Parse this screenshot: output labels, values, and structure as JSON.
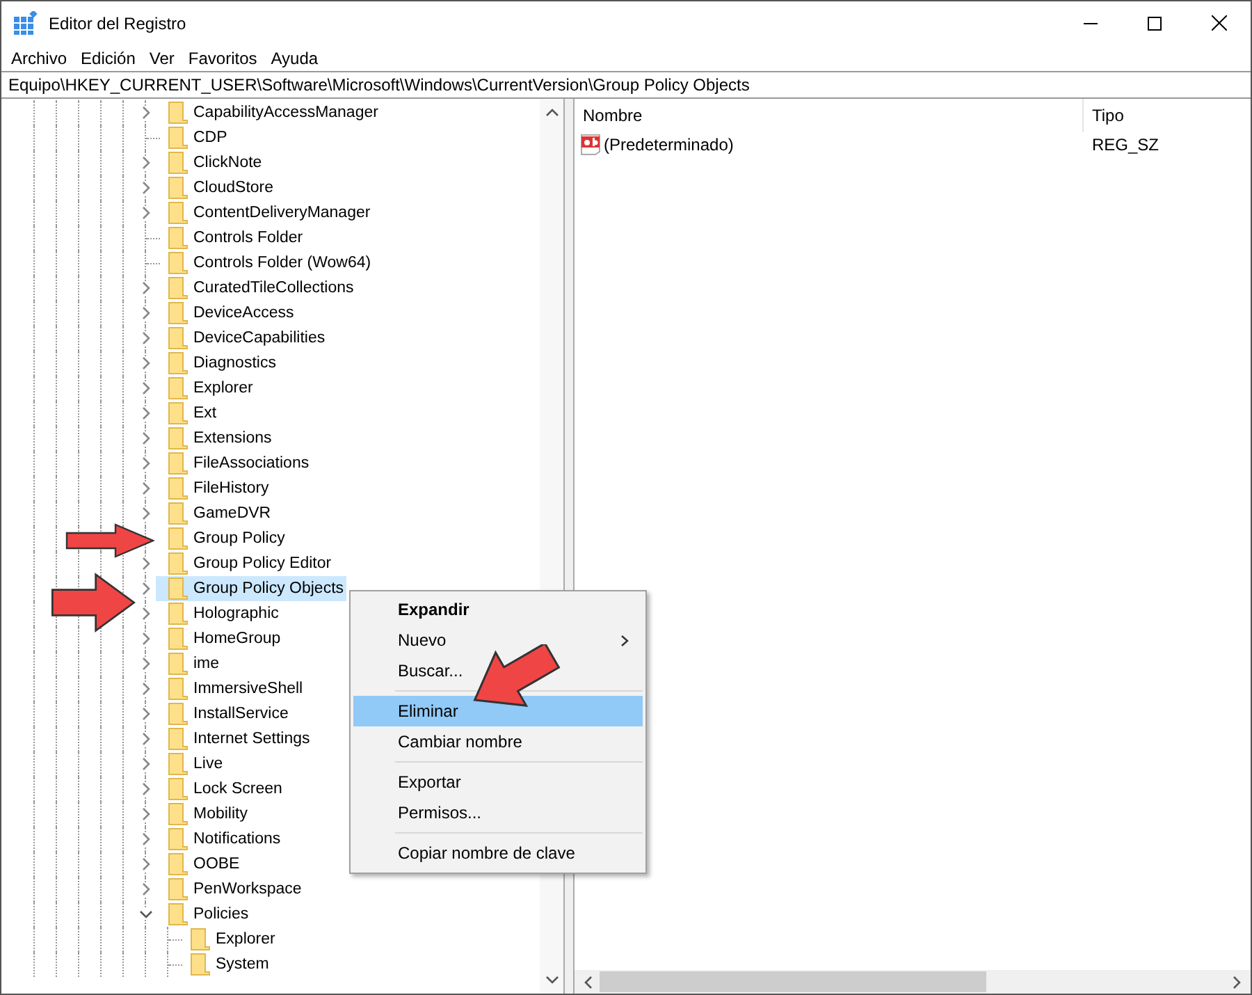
{
  "window": {
    "title": "Editor del Registro"
  },
  "menu": [
    "Archivo",
    "Edición",
    "Ver",
    "Favoritos",
    "Ayuda"
  ],
  "address": "Equipo\\HKEY_CURRENT_USER\\Software\\Microsoft\\Windows\\CurrentVersion\\Group Policy Objects",
  "tree": [
    {
      "label": "CapabilityAccessManager",
      "expandable": true,
      "expanded": false,
      "selected": false
    },
    {
      "label": "CDP",
      "expandable": false,
      "selected": false
    },
    {
      "label": "ClickNote",
      "expandable": true,
      "expanded": false,
      "selected": false
    },
    {
      "label": "CloudStore",
      "expandable": true,
      "expanded": false,
      "selected": false
    },
    {
      "label": "ContentDeliveryManager",
      "expandable": true,
      "expanded": false,
      "selected": false
    },
    {
      "label": "Controls Folder",
      "expandable": false,
      "selected": false
    },
    {
      "label": "Controls Folder (Wow64)",
      "expandable": false,
      "selected": false
    },
    {
      "label": "CuratedTileCollections",
      "expandable": true,
      "expanded": false,
      "selected": false
    },
    {
      "label": "DeviceAccess",
      "expandable": true,
      "expanded": false,
      "selected": false
    },
    {
      "label": "DeviceCapabilities",
      "expandable": true,
      "expanded": false,
      "selected": false
    },
    {
      "label": "Diagnostics",
      "expandable": true,
      "expanded": false,
      "selected": false
    },
    {
      "label": "Explorer",
      "expandable": true,
      "expanded": false,
      "selected": false
    },
    {
      "label": "Ext",
      "expandable": true,
      "expanded": false,
      "selected": false
    },
    {
      "label": "Extensions",
      "expandable": true,
      "expanded": false,
      "selected": false
    },
    {
      "label": "FileAssociations",
      "expandable": true,
      "expanded": false,
      "selected": false
    },
    {
      "label": "FileHistory",
      "expandable": true,
      "expanded": false,
      "selected": false
    },
    {
      "label": "GameDVR",
      "expandable": true,
      "expanded": false,
      "selected": false
    },
    {
      "label": "Group Policy",
      "selected": false
    },
    {
      "label": "Group Policy Editor",
      "expandable": true,
      "expanded": false,
      "selected": false
    },
    {
      "label": "Group Policy Objects",
      "expandable": true,
      "expanded": false,
      "selected": true
    },
    {
      "label": "Holographic",
      "expandable": true,
      "expanded": false,
      "selected": false
    },
    {
      "label": "HomeGroup",
      "expandable": true,
      "expanded": false,
      "selected": false
    },
    {
      "label": "ime",
      "expandable": true,
      "expanded": false,
      "selected": false
    },
    {
      "label": "ImmersiveShell",
      "expandable": true,
      "expanded": false,
      "selected": false
    },
    {
      "label": "InstallService",
      "expandable": true,
      "expanded": false,
      "selected": false
    },
    {
      "label": "Internet Settings",
      "expandable": true,
      "expanded": false,
      "selected": false
    },
    {
      "label": "Live",
      "expandable": true,
      "expanded": false,
      "selected": false
    },
    {
      "label": "Lock Screen",
      "expandable": true,
      "expanded": false,
      "selected": false
    },
    {
      "label": "Mobility",
      "expandable": true,
      "expanded": false,
      "selected": false
    },
    {
      "label": "Notifications",
      "expandable": true,
      "expanded": false,
      "selected": false
    },
    {
      "label": "OOBE",
      "expandable": true,
      "expanded": false,
      "selected": false
    },
    {
      "label": "PenWorkspace",
      "expandable": true,
      "expanded": false,
      "selected": false
    },
    {
      "label": "Policies",
      "expandable": true,
      "expanded": true,
      "selected": false,
      "children": [
        {
          "label": "Explorer",
          "expandable": false,
          "selected": false
        },
        {
          "label": "System",
          "expandable": false,
          "selected": false
        }
      ]
    }
  ],
  "values": {
    "columns": [
      "Nombre",
      "Tipo"
    ],
    "rows": [
      {
        "name": "(Predeterminado)",
        "type": "REG_SZ"
      }
    ]
  },
  "context_menu": [
    {
      "kind": "item",
      "label": "Expandir",
      "default": true,
      "submenu": false,
      "selected": false
    },
    {
      "kind": "item",
      "label": "Nuevo",
      "default": false,
      "submenu": true,
      "selected": false
    },
    {
      "kind": "item",
      "label": "Buscar...",
      "default": false,
      "submenu": false,
      "selected": false
    },
    {
      "kind": "separator"
    },
    {
      "kind": "item",
      "label": "Eliminar",
      "default": false,
      "submenu": false,
      "selected": true
    },
    {
      "kind": "item",
      "label": "Cambiar nombre",
      "default": false,
      "submenu": false,
      "selected": false
    },
    {
      "kind": "separator"
    },
    {
      "kind": "item",
      "label": "Exportar",
      "default": false,
      "submenu": false,
      "selected": false
    },
    {
      "kind": "item",
      "label": "Permisos...",
      "default": false,
      "submenu": false,
      "selected": false
    },
    {
      "kind": "separator"
    },
    {
      "kind": "item",
      "label": "Copiar nombre de clave",
      "default": false,
      "submenu": false,
      "selected": false
    }
  ]
}
